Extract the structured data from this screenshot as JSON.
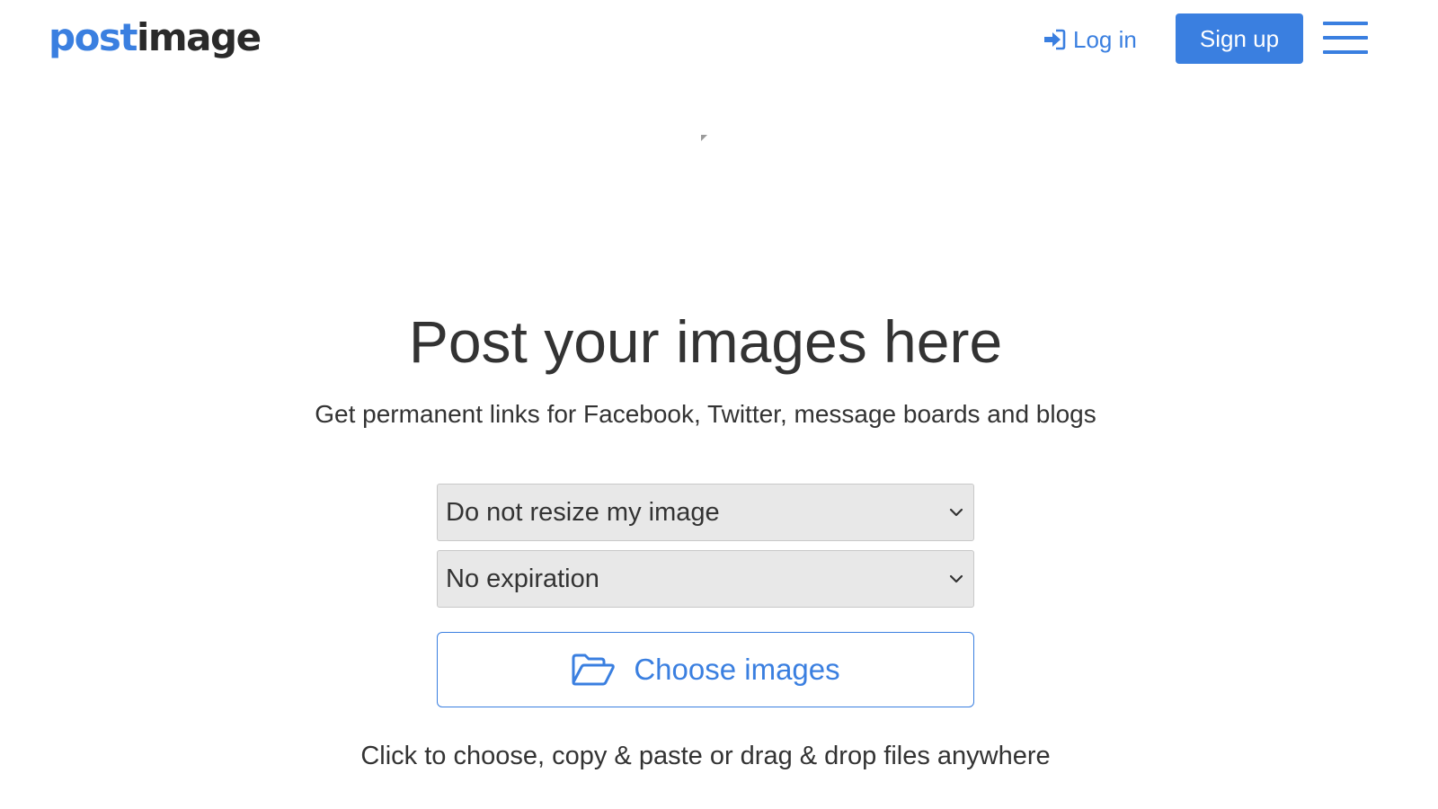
{
  "header": {
    "logo_part1": "post",
    "logo_part2": "image",
    "login_label": "Log in",
    "signup_label": "Sign up"
  },
  "hero": {
    "title": "Post your images here",
    "subtitle": "Get permanent links for Facebook, Twitter, message boards and blogs"
  },
  "upload": {
    "resize_selected": "Do not resize my image",
    "expiration_selected": "No expiration",
    "choose_label": "Choose images",
    "hint": "Click to choose, copy & paste or drag & drop files anywhere"
  },
  "colors": {
    "accent": "#3a7fe0",
    "text": "#333333",
    "select_bg": "#e8e8e8"
  },
  "icons": {
    "login": "sign-in-icon",
    "menu": "hamburger-menu-icon",
    "folder": "folder-open-icon",
    "chevron": "chevron-down-icon"
  }
}
